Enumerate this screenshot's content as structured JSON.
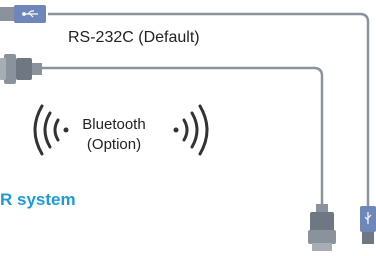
{
  "labels": {
    "rs232": "RS-232C (Default)",
    "bluetooth_line1": "Bluetooth",
    "bluetooth_line2": "(Option)",
    "system": "R system"
  },
  "colors": {
    "cable": "#8a929c",
    "connector_dark": "#6f7782",
    "usb_blue": "#6e86b8",
    "accent": "#1e9bd7",
    "wave": "#333333"
  },
  "icons": [
    "usb-icon",
    "db9-connector-icon",
    "wireless-waves-icon"
  ]
}
